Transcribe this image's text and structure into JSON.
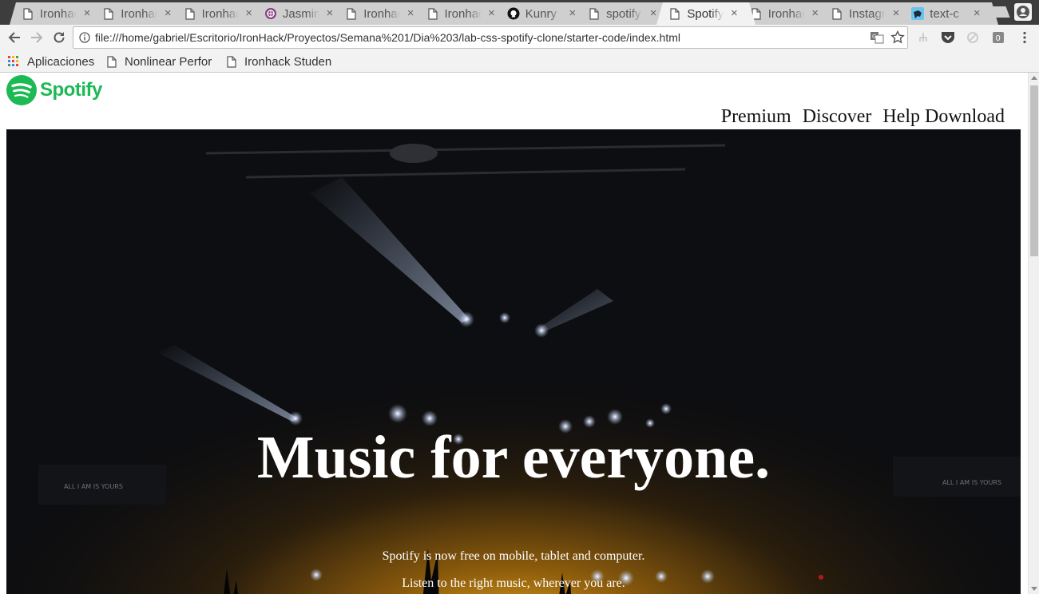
{
  "browser": {
    "tabs": [
      {
        "title": "Ironhack",
        "icon": "page-icon",
        "active": false
      },
      {
        "title": "Ironhack",
        "icon": "page-icon",
        "active": false
      },
      {
        "title": "Ironhack",
        "icon": "page-icon",
        "active": false
      },
      {
        "title": "Jasmine",
        "icon": "jasmine-icon",
        "active": false
      },
      {
        "title": "Ironhack",
        "icon": "page-icon",
        "active": false
      },
      {
        "title": "Ironhack",
        "icon": "page-icon",
        "active": false
      },
      {
        "title": "Kunry",
        "icon": "github-icon",
        "active": false
      },
      {
        "title": "spotify",
        "icon": "page-icon",
        "active": false
      },
      {
        "title": "Spotify",
        "icon": "page-icon",
        "active": true
      },
      {
        "title": "Ironhack",
        "icon": "page-icon",
        "active": false
      },
      {
        "title": "Instagram",
        "icon": "page-icon",
        "active": false
      },
      {
        "title": "text-c",
        "icon": "bird-icon",
        "active": false
      }
    ],
    "close_glyph": "×",
    "url": "file:///home/gabriel/Escritorio/IronHack/Proyectos/Semana%201/Dia%203/lab-css-spotify-clone/starter-code/index.html",
    "bookmarks": [
      {
        "label": "Aplicaciones",
        "icon": "apps-grid-icon"
      },
      {
        "label": "Nonlinear Perfor",
        "icon": "page-icon"
      },
      {
        "label": "Ironhack Studen",
        "icon": "page-icon"
      }
    ]
  },
  "page": {
    "logo_text": "Spotify",
    "nav": [
      "Premium",
      "Discover",
      "Help Download"
    ],
    "hero": {
      "title": "Music for everyone.",
      "line1": "Spotify is now free on mobile, tablet and computer.",
      "line2": "Listen to the right music, wherever you are.",
      "stage_sign": "ALL I AM IS YOURS"
    }
  },
  "colors": {
    "spotify_green": "#1db954",
    "tabstrip": "#3d3d3d",
    "chrome": "#f2f2f2"
  }
}
